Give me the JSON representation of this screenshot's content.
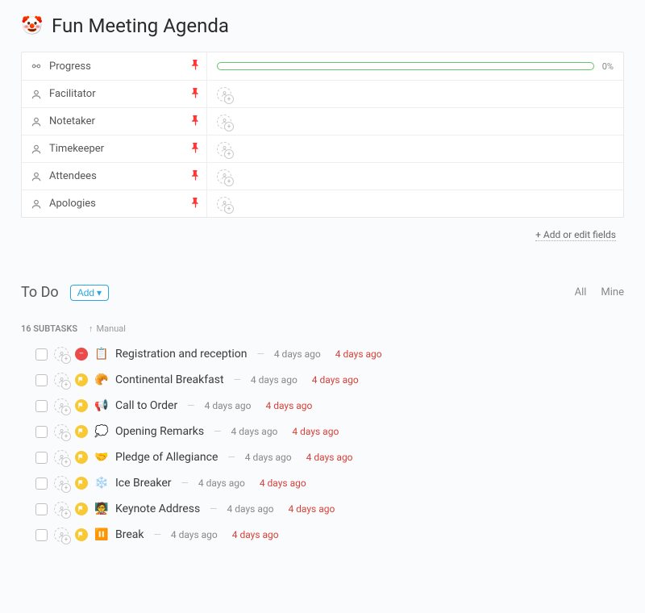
{
  "header": {
    "icon": "🤡",
    "title": "Fun Meeting Agenda"
  },
  "fields": [
    {
      "icon": "progress",
      "label": "Progress",
      "type": "progress",
      "value_pct": "0%"
    },
    {
      "icon": "person",
      "label": "Facilitator",
      "type": "assignee"
    },
    {
      "icon": "person",
      "label": "Notetaker",
      "type": "assignee"
    },
    {
      "icon": "person",
      "label": "Timekeeper",
      "type": "assignee"
    },
    {
      "icon": "person",
      "label": "Attendees",
      "type": "assignee"
    },
    {
      "icon": "person",
      "label": "Apologies",
      "type": "assignee"
    }
  ],
  "add_fields_label": "+ Add or edit fields",
  "todo": {
    "title": "To Do",
    "add_label": "Add",
    "filter_all": "All",
    "filter_mine": "Mine",
    "subtask_count_label": "16 SUBTASKS",
    "sort_label": "Manual"
  },
  "tasks": [
    {
      "status": "red",
      "emoji": "📋",
      "title": "Registration and reception",
      "date1": "4 days ago",
      "date2": "4 days ago"
    },
    {
      "status": "yellow",
      "emoji": "🥐",
      "title": "Continental Breakfast",
      "date1": "4 days ago",
      "date2": "4 days ago"
    },
    {
      "status": "yellow",
      "emoji": "📢",
      "title": "Call to Order",
      "date1": "4 days ago",
      "date2": "4 days ago"
    },
    {
      "status": "yellow",
      "emoji": "💭",
      "title": "Opening Remarks",
      "date1": "4 days ago",
      "date2": "4 days ago"
    },
    {
      "status": "yellow",
      "emoji": "🤝",
      "title": "Pledge of Allegiance",
      "date1": "4 days ago",
      "date2": "4 days ago"
    },
    {
      "status": "yellow",
      "emoji": "❄️",
      "title": "Ice Breaker",
      "date1": "4 days ago",
      "date2": "4 days ago"
    },
    {
      "status": "yellow",
      "emoji": "🧑‍🏫",
      "title": "Keynote Address",
      "date1": "4 days ago",
      "date2": "4 days ago"
    },
    {
      "status": "yellow",
      "emoji": "⏸️",
      "title": "Break",
      "date1": "4 days ago",
      "date2": "4 days ago"
    }
  ]
}
